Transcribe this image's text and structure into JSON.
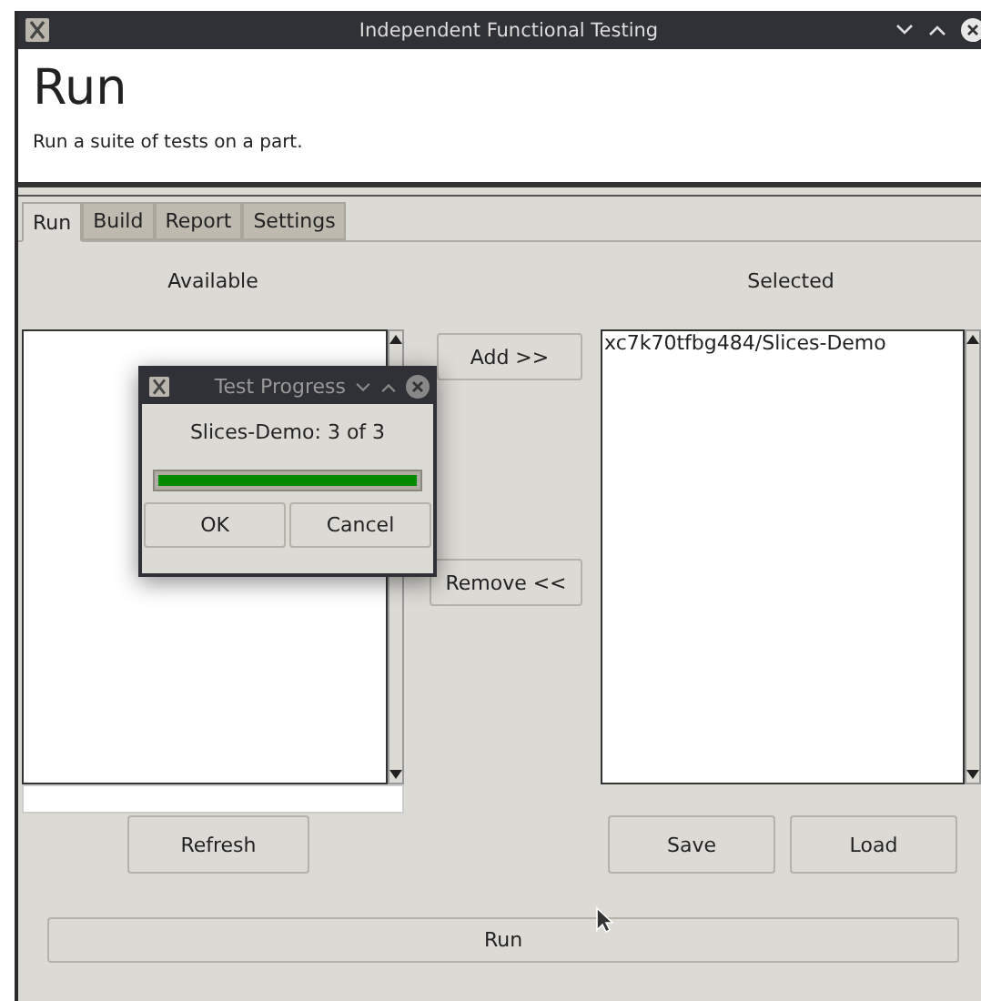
{
  "window": {
    "title": "Independent Functional Testing"
  },
  "header": {
    "title": "Run",
    "description": "Run a suite of tests on a part."
  },
  "tabs": [
    {
      "label": "Run",
      "selected": true
    },
    {
      "label": "Build",
      "selected": false
    },
    {
      "label": "Report",
      "selected": false
    },
    {
      "label": "Settings",
      "selected": false
    }
  ],
  "available": {
    "heading": "Available",
    "button": "Refresh"
  },
  "transfer_buttons": [
    "Add >>",
    "Remove <<"
  ],
  "selected": {
    "heading": "Selected",
    "items": [
      "xc7k70tfbg484/Slices-Demo"
    ],
    "buttons": [
      "Save",
      "Load"
    ]
  },
  "run_button": "Run",
  "dialog": {
    "title": "Test Progress",
    "message": "Slices-Demo: 3 of 3",
    "level": 1.0,
    "buttons": [
      "OK",
      "Cancel"
    ]
  }
}
